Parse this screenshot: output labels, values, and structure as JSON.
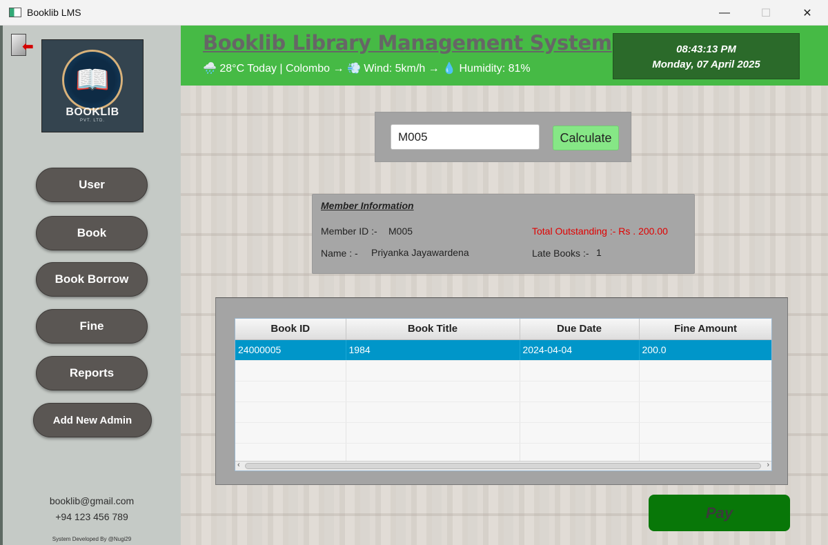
{
  "window": {
    "title": "Booklib LMS",
    "minimize": "—",
    "maximize": "☐",
    "close": "✕"
  },
  "sidebar": {
    "logo": {
      "text": "BOOKLIB",
      "sub": "PVT. LTD."
    },
    "nav": [
      {
        "label": "User"
      },
      {
        "label": "Book"
      },
      {
        "label": "Book Borrow"
      },
      {
        "label": "Fine"
      },
      {
        "label": "Reports"
      },
      {
        "label": "Add New Admin"
      }
    ],
    "email": "booklib@gmail.com",
    "phone": "+94 123 456 789",
    "developer": "System Developed By @Nugi29"
  },
  "header": {
    "title": "Booklib Library Management System",
    "weather": "🌧️ 28°C Today | Colombo → 💨 Wind: 5km/h → 💧 Humidity: 81%",
    "time": "08:43:13 PM",
    "date": "Monday, 07 April 2025"
  },
  "search": {
    "value": "M005",
    "button": "Calculate"
  },
  "member": {
    "heading": "Member Information",
    "id_label": "Member ID :-",
    "id_value": "M005",
    "name_label": "Name : -",
    "name_value": "Priyanka Jayawardena",
    "outstanding_label": "Total Outstanding :- Rs . 200.00",
    "late_label": "Late Books :-",
    "late_value": "1"
  },
  "table": {
    "columns": [
      "Book ID",
      "Book Title",
      "Due Date",
      "Fine Amount"
    ],
    "rows": [
      [
        "24000005",
        "1984",
        "2024-04-04",
        "200.0"
      ]
    ]
  },
  "pay": {
    "label": "Pay"
  },
  "colors": {
    "header_green": "#46ba45",
    "clock_bg": "#2b6a2a",
    "calc_green": "#86e786",
    "pay_green": "#087708",
    "selection_blue": "#0096c9",
    "outstanding_red": "#e00000"
  }
}
